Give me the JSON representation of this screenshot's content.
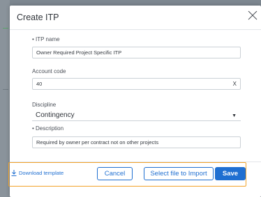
{
  "modal": {
    "title": "Create ITP"
  },
  "fields": {
    "itp_name": {
      "label": "• ITP name",
      "value": "Owner Required Project Specific ITP"
    },
    "account_code": {
      "label": "Account code",
      "value": "40",
      "clear_label": "X"
    },
    "discipline": {
      "label": "Discipline",
      "selected": "Contingency"
    },
    "description": {
      "label": "• Description",
      "value": "Required by owner per contract not on other projects"
    }
  },
  "footer": {
    "download_label": "Download template",
    "cancel_label": "Cancel",
    "import_label": "Select file to Import",
    "save_label": "Save"
  },
  "colors": {
    "accent": "#1f6fd1",
    "highlight": "#f2a32a"
  },
  "icons": {
    "close": "close-icon",
    "download": "download-icon",
    "caret": "chevron-down-icon"
  }
}
